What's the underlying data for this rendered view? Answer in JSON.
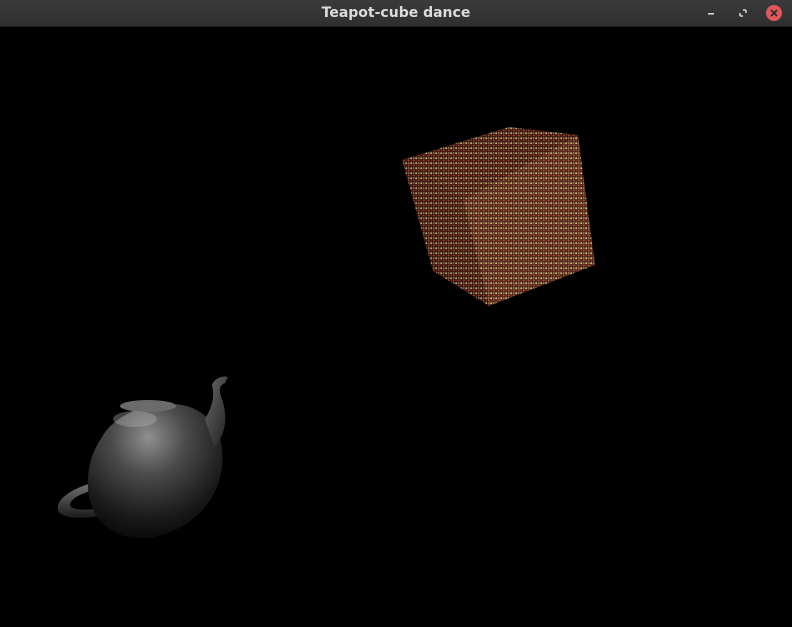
{
  "window": {
    "title": "Teapot-cube dance"
  },
  "controls": {
    "minimize_icon": "minimize-icon",
    "maximize_icon": "maximize-icon",
    "close_icon": "close-icon",
    "close_color": "#e0575b"
  },
  "scene": {
    "background": "#000000",
    "cube_color": "#c77a55",
    "teapot_color": "#8a8a8a"
  }
}
